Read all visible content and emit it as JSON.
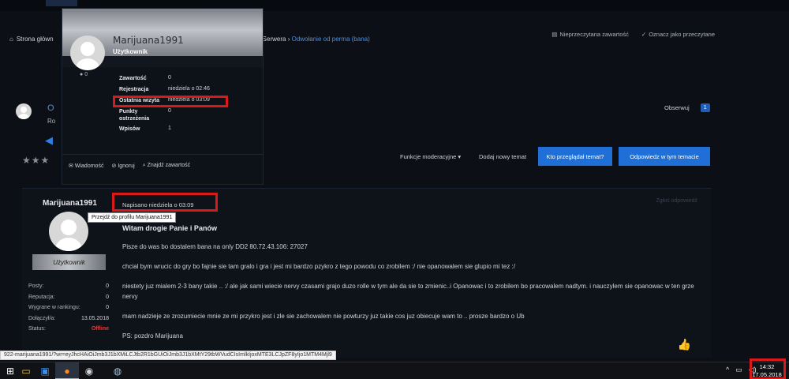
{
  "breadcrumb": {
    "home": "Strona główna",
    "home_truncated": "Strona główn",
    "tail_before": "e Serwera",
    "current": "Odwołanie od perma (bana)"
  },
  "top_actions": {
    "unread": "Nieprzeczytana zawartość",
    "mark_read": "Oznacz jako przeczytane"
  },
  "thread": {
    "follow_label": "Obserwuj",
    "follow_count": "1",
    "title_stub": "O",
    "sub_stub": "Ro"
  },
  "actions": {
    "moderation": "Funkcje moderacyjne ▾",
    "new_topic": "Dodaj nowy temat",
    "who_viewed": "Kto przeglądał temat?",
    "reply": "Odpowiedz w tym temacie"
  },
  "hovercard": {
    "name": "Marijuana1991",
    "rank": "Użytkownik",
    "online_dot": "0",
    "rows": [
      {
        "k": "Zawartość",
        "v": "0"
      },
      {
        "k": "Rejestracja",
        "v": "niedziela o 02:46"
      },
      {
        "k": "Ostatnia wizyta",
        "v": "niedziela o 03:09"
      },
      {
        "k": "Punkty ostrzeżenia",
        "v": "0"
      },
      {
        "k": "Wpisów",
        "v": "1"
      }
    ],
    "actions": {
      "message": "Wiadomość",
      "ignore": "Ignoruj",
      "find": "Znajdź zawartość"
    }
  },
  "post": {
    "author": "Marijuana1991",
    "tooltip": "Przejdź do profilu Marijuana1991",
    "rank": "Użytkownik",
    "written": "Napisano niedziela o 03:09",
    "top_right": "Zgłoś odpowiedź",
    "stats": [
      {
        "k": "Posty:",
        "v": "0",
        "red": false
      },
      {
        "k": "Reputacja:",
        "v": "0",
        "red": false
      },
      {
        "k": "Wygrane w rankingu:",
        "v": "0",
        "red": false
      },
      {
        "k": "Dołączył/a:",
        "v": "13.05.2018",
        "red": false
      },
      {
        "k": "Status:",
        "v": "Offline",
        "red": true
      }
    ],
    "title": "Witam drogie Panie i Panów",
    "paragraphs": [
      "Pisze do was bo dostalem bana na only DD2 80.72.43.106: 27027",
      "chcial bym wrucic do gry bo fajnie sie tam gralo i gra i jest mi bardzo pzykro z tego powodu co zrobilem :/ nie opanowalem sie glupio mi tez :/",
      "niestety juz mialem 2-3 bany takie .. :/ ale jak sami wiecie nervy czasami grajo duzo rolle w tym ale da sie to zmienic..i  Opanowac i to zrobilem bo pracowalem nadtym.  i nauczylem sie opanowac w ten grze nervy",
      "mam nadzieje ze zrozumiecie mnie ze mi przykro jest i zle sie zachowalem nie powturzy juz takie cos juz obiecuje wam to .. prosze bardzo o Ub",
      "PS: pozdro Marijuana"
    ]
  },
  "status_url": "922-marijuana1991/?wr=eyJhcHAiOiJmb3J1bXMiLCJtb2R1bGUiOiJmb3J1bXMtY29tbWVudCIsImlkIjoxMTE3LCJpZF8yIjo1MTM4Mjl9",
  "taskbar": {
    "time": "14:32",
    "date": "17.05.2018"
  },
  "colors": {
    "accent": "#1f6fd6",
    "link": "#4c8fe0",
    "highlight_box": "#d81a1a",
    "offline": "#e23b3b"
  }
}
